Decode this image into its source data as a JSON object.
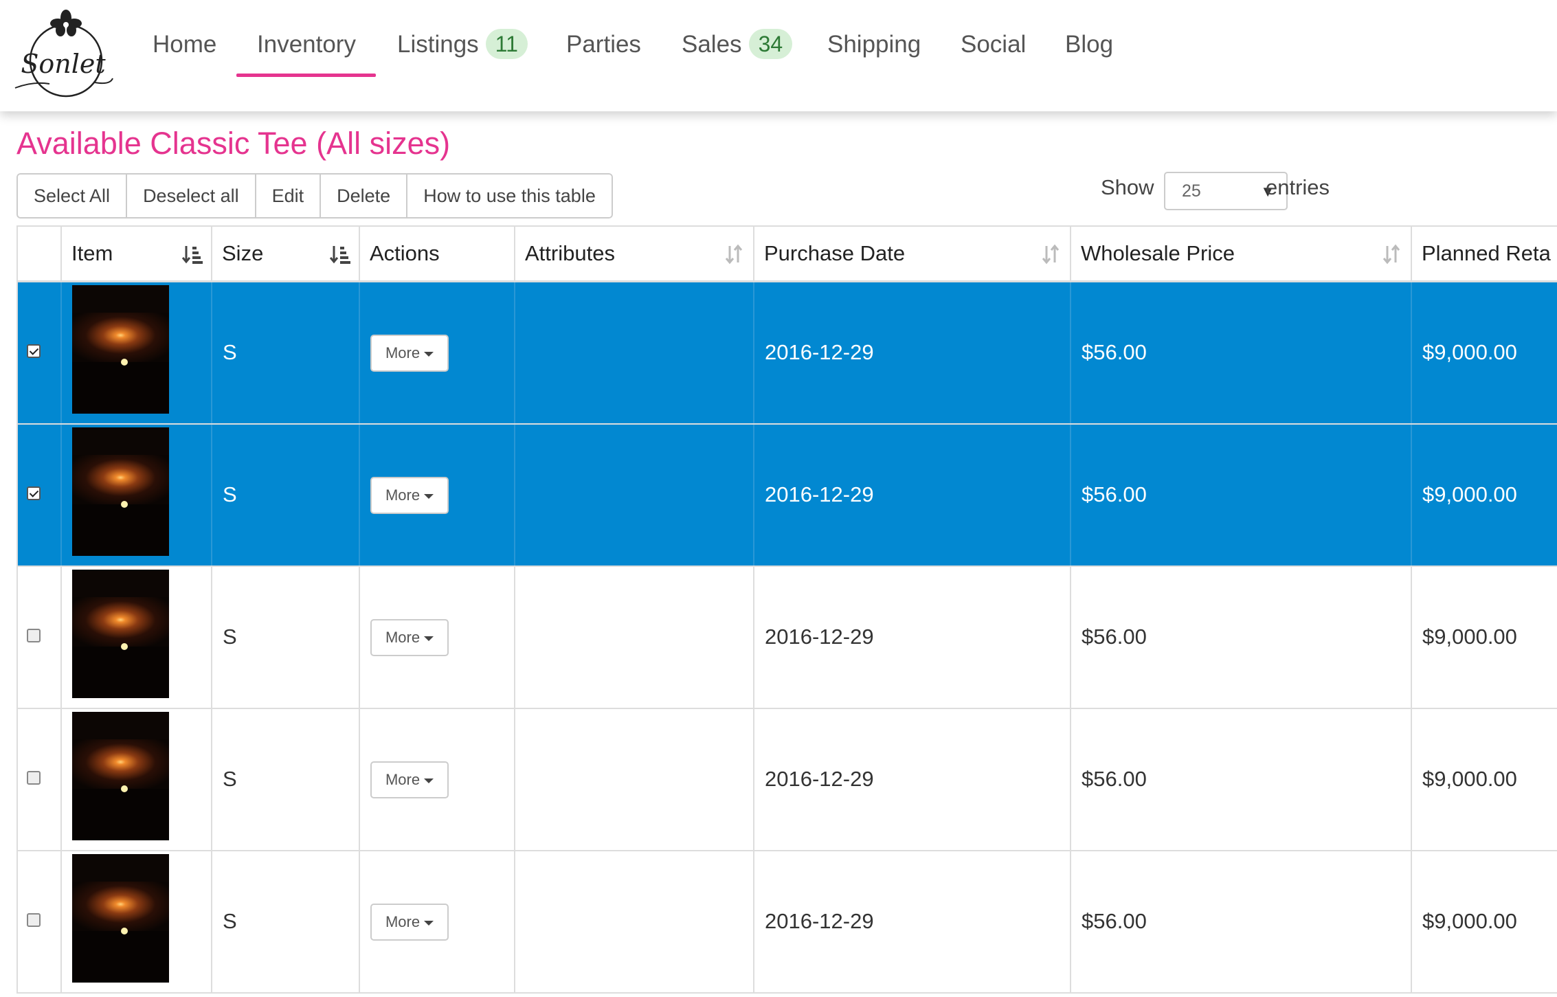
{
  "brand": {
    "logo_text": "Sonlet"
  },
  "nav": {
    "items": [
      {
        "label": "Home",
        "badge": null,
        "active": false
      },
      {
        "label": "Inventory",
        "badge": null,
        "active": true
      },
      {
        "label": "Listings",
        "badge": "11",
        "active": false
      },
      {
        "label": "Parties",
        "badge": null,
        "active": false
      },
      {
        "label": "Sales",
        "badge": "34",
        "active": false
      },
      {
        "label": "Shipping",
        "badge": null,
        "active": false
      },
      {
        "label": "Social",
        "badge": null,
        "active": false
      },
      {
        "label": "Blog",
        "badge": null,
        "active": false
      }
    ]
  },
  "page": {
    "title": "Available Classic Tee (All sizes)"
  },
  "toolbar": {
    "select_all": "Select All",
    "deselect_all": "Deselect all",
    "edit": "Edit",
    "delete": "Delete",
    "help": "How to use this table"
  },
  "length_menu": {
    "show_label": "Show",
    "value": "25",
    "entries_label": "entries"
  },
  "table": {
    "columns": [
      "",
      "Item",
      "Size",
      "Actions",
      "Attributes",
      "Purchase Date",
      "Wholesale Price",
      "Planned Reta"
    ],
    "more_label": "More",
    "rows": [
      {
        "selected": true,
        "size": "S",
        "attributes": "",
        "purchase_date": "2016-12-29",
        "wholesale_price": "$56.00",
        "planned_retail": "$9,000.00"
      },
      {
        "selected": true,
        "size": "S",
        "attributes": "",
        "purchase_date": "2016-12-29",
        "wholesale_price": "$56.00",
        "planned_retail": "$9,000.00"
      },
      {
        "selected": false,
        "size": "S",
        "attributes": "",
        "purchase_date": "2016-12-29",
        "wholesale_price": "$56.00",
        "planned_retail": "$9,000.00"
      },
      {
        "selected": false,
        "size": "S",
        "attributes": "",
        "purchase_date": "2016-12-29",
        "wholesale_price": "$56.00",
        "planned_retail": "$9,000.00"
      },
      {
        "selected": false,
        "size": "S",
        "attributes": "",
        "purchase_date": "2016-12-29",
        "wholesale_price": "$56.00",
        "planned_retail": "$9,000.00"
      }
    ]
  },
  "colors": {
    "accent": "#e5348f",
    "selected_row": "#0288d1",
    "badge_bg": "#d6efd6",
    "badge_text": "#2d7a35"
  }
}
